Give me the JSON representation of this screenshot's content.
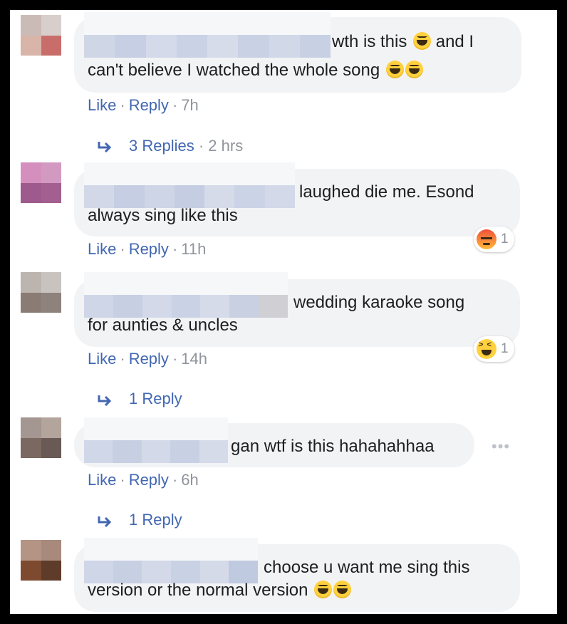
{
  "comments": [
    {
      "id": "c1",
      "text_line1": "wth is this",
      "text_line1_tail": "and I",
      "text_line2": "can't believe I watched the whole song",
      "like": "Like",
      "reply": "Reply",
      "time": "7h",
      "replies": {
        "label": "3 Replies",
        "time": "2 hrs"
      }
    },
    {
      "id": "c2",
      "text_line1": "laughed die me. Esond",
      "text_line2": "always sing like this",
      "like": "Like",
      "reply": "Reply",
      "time": "11h",
      "reaction": {
        "icon": "angry-reaction-icon",
        "count": "1"
      }
    },
    {
      "id": "c3",
      "text_line1": "wedding karaoke song",
      "text_line2": "for aunties & uncles",
      "like": "Like",
      "reply": "Reply",
      "time": "14h",
      "reaction": {
        "icon": "laughing-squint-reaction-icon",
        "count": "1"
      },
      "replies": {
        "label": "1 Reply"
      }
    },
    {
      "id": "c4",
      "text_line1": "gan wtf is this hahahahhaa",
      "like": "Like",
      "reply": "Reply",
      "time": "6h",
      "more": "•••",
      "replies": {
        "label": "1 Reply"
      }
    },
    {
      "id": "c5",
      "text_line1": "choose u want me sing this",
      "text_line2": "version or the normal version"
    }
  ],
  "colors": {
    "link": "#4267b2",
    "meta": "#90949c",
    "bubble": "#f2f3f5",
    "text": "#1c1e21"
  }
}
